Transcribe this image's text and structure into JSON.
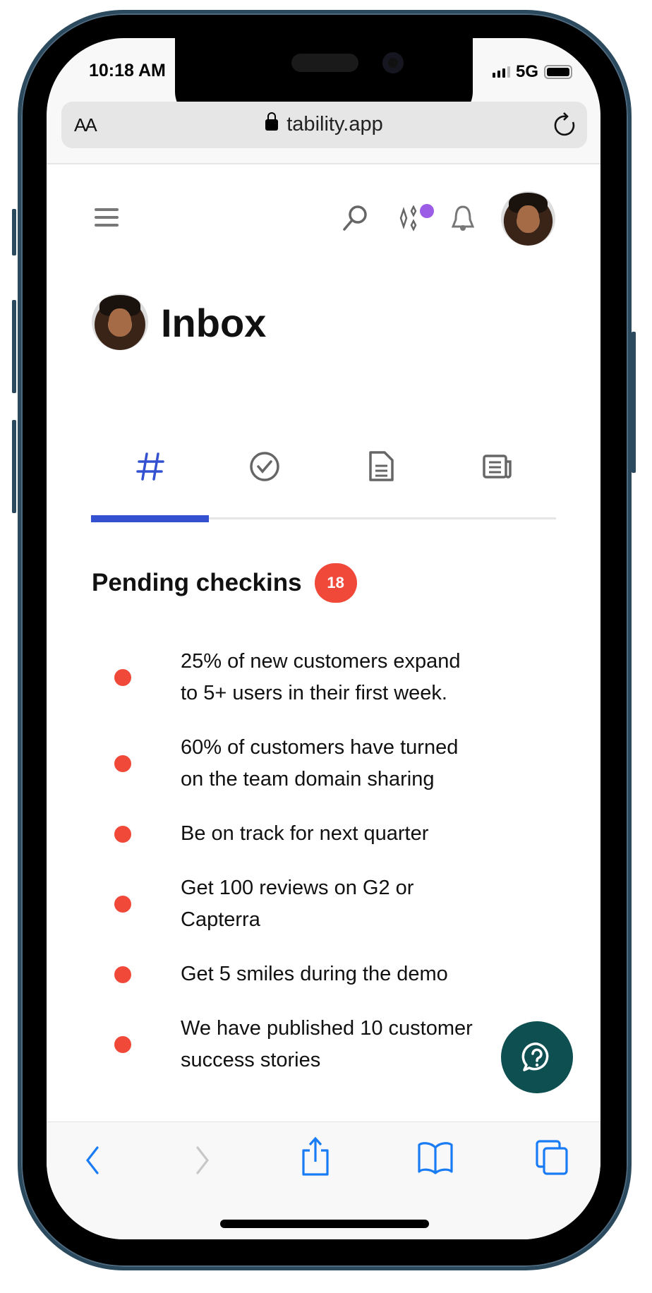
{
  "status_bar": {
    "time": "10:18 AM",
    "network": "5G"
  },
  "browser": {
    "text_size_label": "AA",
    "url": "tability.app"
  },
  "header": {
    "icons": [
      "menu-icon",
      "search-icon",
      "sparkles-icon",
      "bell-icon",
      "avatar"
    ],
    "notification_dot_color": "#9b5de5"
  },
  "page": {
    "title": "Inbox",
    "tabs": [
      "checkins-tab",
      "tasks-tab",
      "documents-tab",
      "news-tab"
    ],
    "active_tab": 0,
    "accent": "#3451d1"
  },
  "section": {
    "title": "Pending checkins",
    "count": "18",
    "badge_color": "#f0493a"
  },
  "items": [
    {
      "label": "25% of new customers expand to 5+ users in their first week."
    },
    {
      "label": "60% of customers have turned on the team domain sharing"
    },
    {
      "label": "Be on track for next quarter"
    },
    {
      "label": "Get 100 reviews on G2 or Capterra"
    },
    {
      "label": "Get 5 smiles during the demo"
    },
    {
      "label": "We have published 10 customer success stories"
    }
  ],
  "help_button_color": "#0e4f52",
  "toolbar": [
    "back",
    "forward",
    "share",
    "bookmarks",
    "tabs"
  ]
}
